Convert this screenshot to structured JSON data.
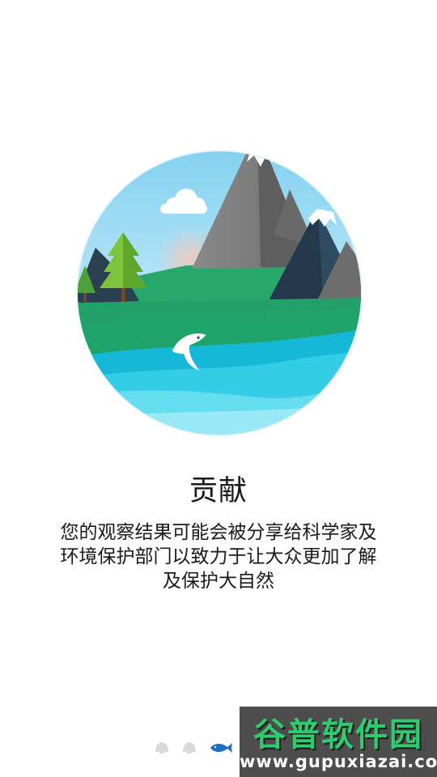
{
  "onboarding": {
    "title": "贡献",
    "description_lines": [
      "您的观察结果可能会被分享给科学家及",
      "环境保护部门以致力于让大众更加了解",
      "及保护大自然"
    ]
  },
  "pager": {
    "total": 3,
    "active_index": 2,
    "inactive_icon": "shell-icon",
    "active_icon": "fish-icon",
    "inactive_color": "#d9d9d9",
    "active_color": "#1e6fc7"
  },
  "watermark": {
    "name": "谷普软件园",
    "url": "www.gupuxiazai.com"
  }
}
